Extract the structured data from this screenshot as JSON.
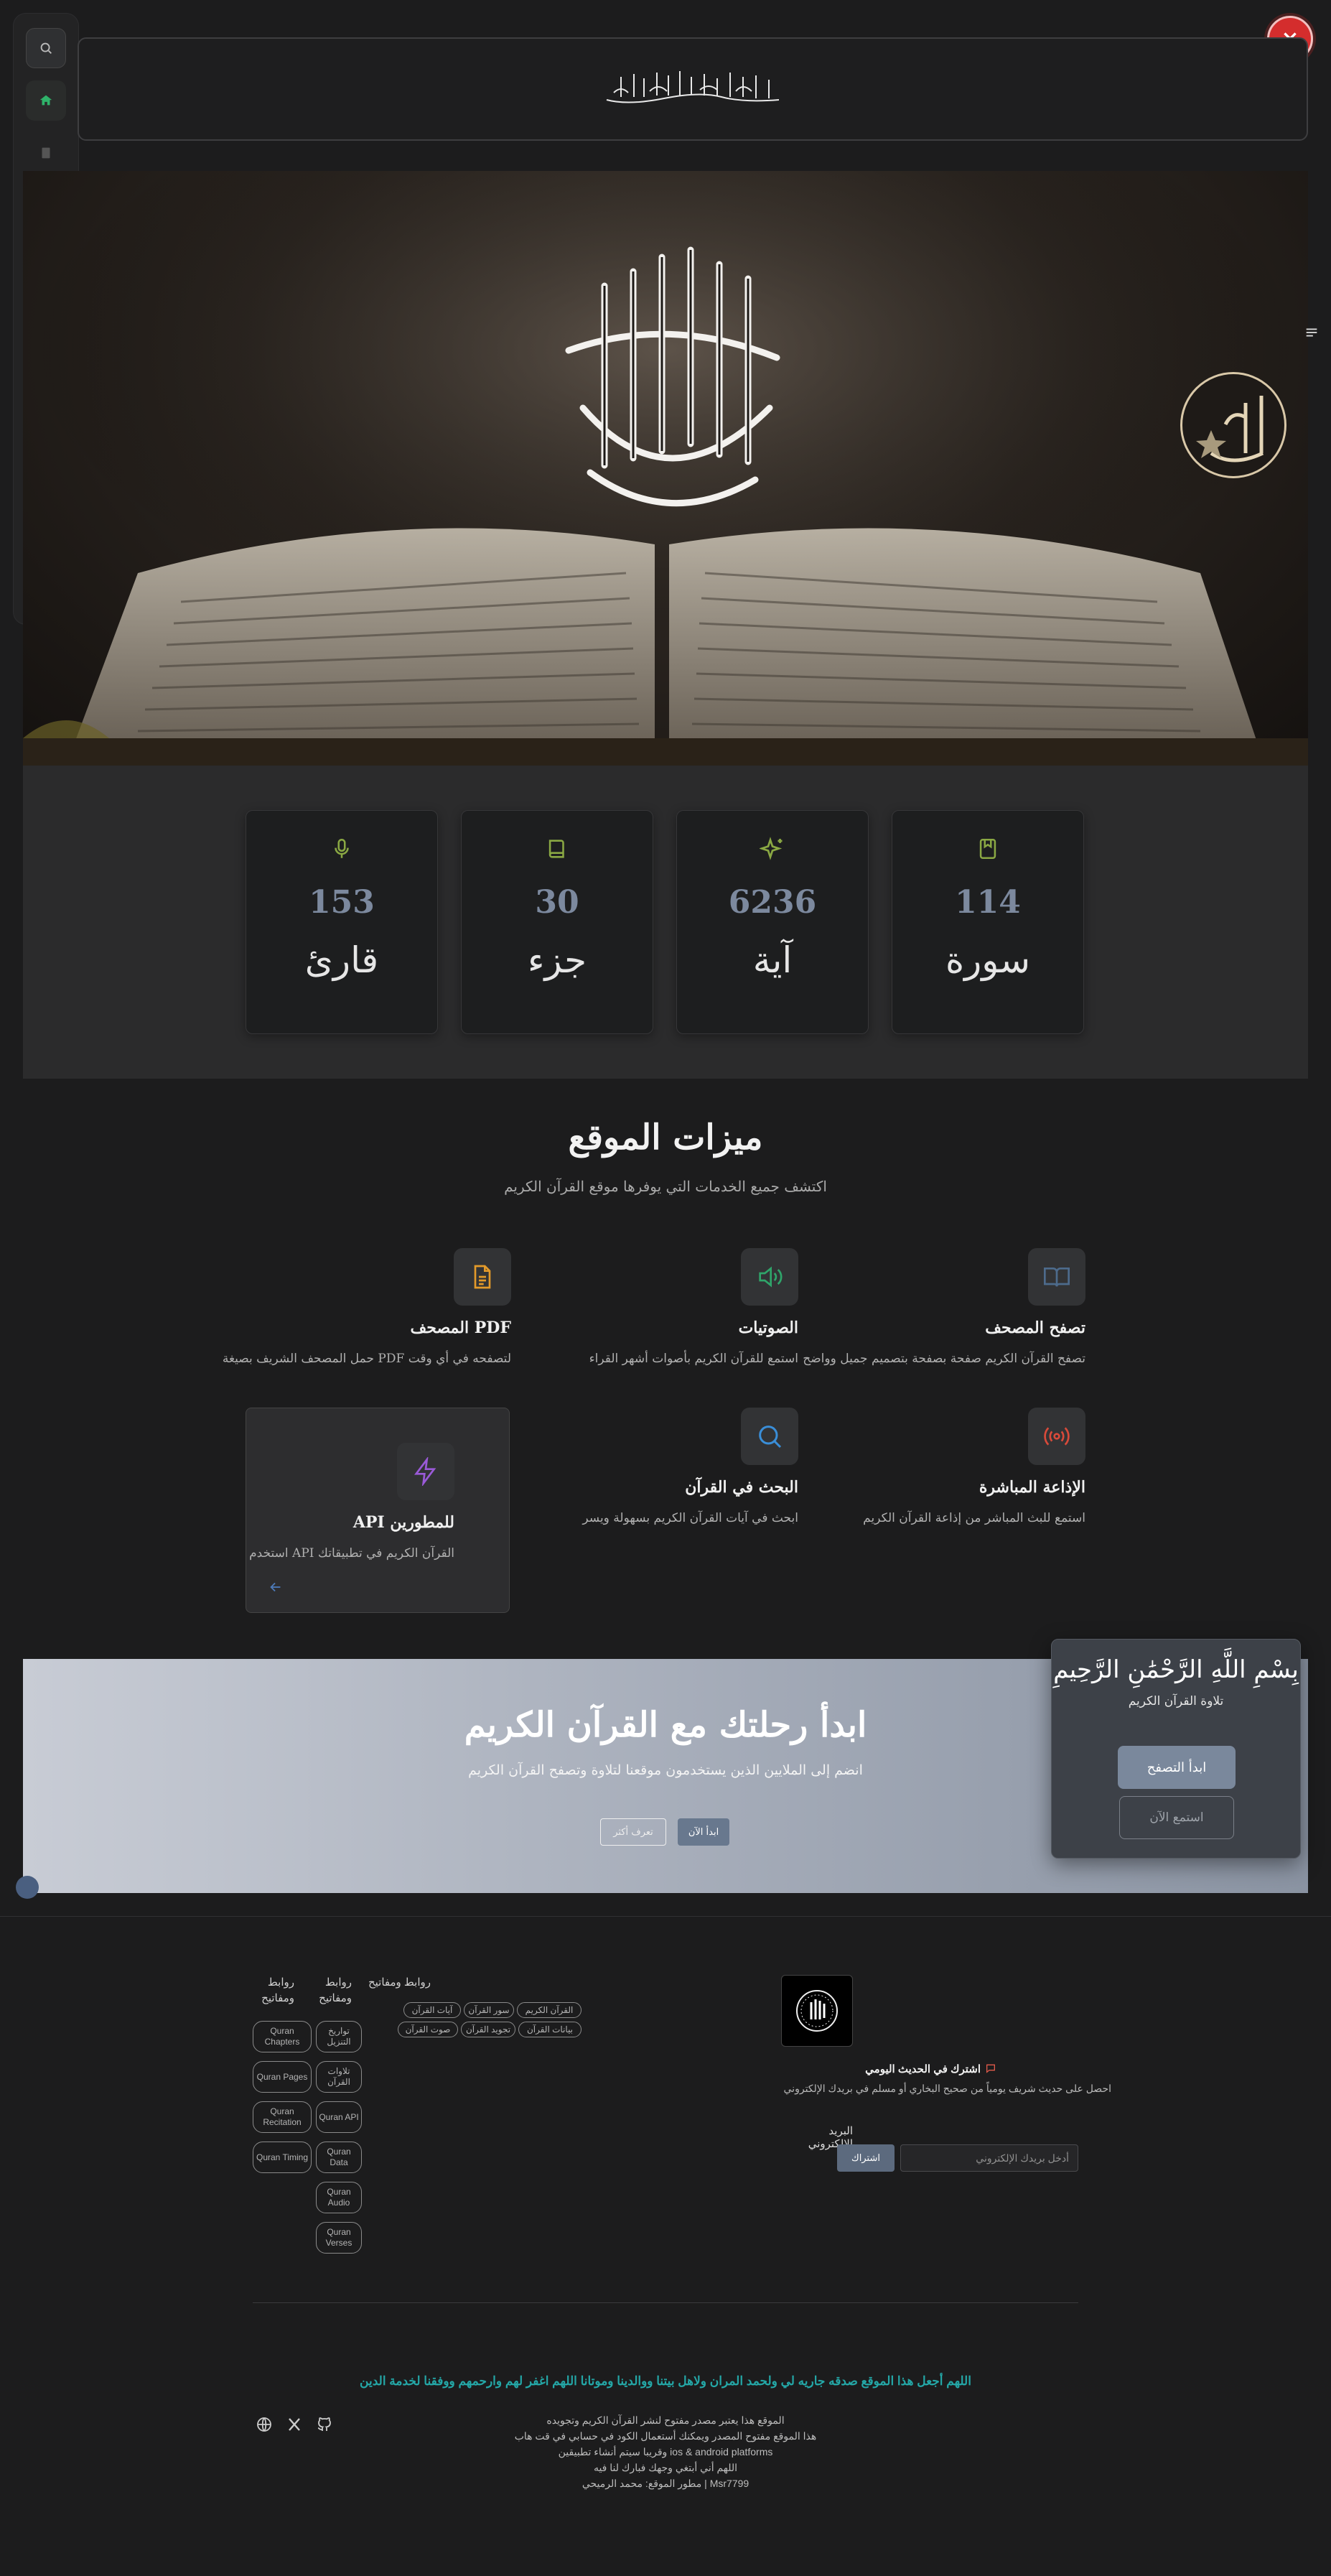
{
  "header": {
    "basmala": "بسم الله الرحمن الرحيم"
  },
  "hero": {
    "calligraphy": "القرآن الكريم",
    "badge": "الم"
  },
  "sidebar": {
    "items": [
      {
        "icon": "search-icon"
      },
      {
        "icon": "home-icon"
      },
      {
        "icon": "book-icon"
      },
      {
        "icon": "reader-icon"
      },
      {
        "icon": "audio-icon"
      },
      {
        "icon": "mushaf-icon"
      },
      {
        "icon": "video-icon"
      },
      {
        "icon": "bookmark-icon"
      },
      {
        "icon": "globe-icon"
      },
      {
        "icon": "sun-icon"
      }
    ]
  },
  "stats": [
    {
      "number": "114",
      "label": "سورة",
      "icon": "bookmark-icon"
    },
    {
      "number": "6236",
      "label": "آية",
      "icon": "sparkles-icon"
    },
    {
      "number": "30",
      "label": "جزء",
      "icon": "book-icon"
    },
    {
      "number": "153",
      "label": "قارئ",
      "icon": "microphone-icon"
    }
  ],
  "features": {
    "title": "ميزات الموقع",
    "subtitle": "اكتشف جميع الخدمات التي يوفرها موقع القرآن الكريم",
    "items": [
      {
        "title": "تصفح المصحف",
        "desc": "تصفح القرآن الكريم صفحة بصفحة بتصميم جميل وواضح",
        "icon": "open-book-icon",
        "color": "#4d6b8c"
      },
      {
        "title": "الصوتيات",
        "desc": "استمع للقرآن الكريم بأصوات أشهر القراء",
        "icon": "speaker-icon",
        "color": "#2fa56a"
      },
      {
        "title": "المصحف PDF",
        "desc": "حمل المصحف الشريف بصيغة PDF لتصفحه في أي وقت",
        "icon": "document-icon",
        "color": "#e39a2a"
      },
      {
        "title": "الإذاعة المباشرة",
        "desc": "استمع للبث المباشر من إذاعة القرآن الكريم",
        "icon": "radio-icon",
        "color": "#d84a3a"
      },
      {
        "title": "البحث في القرآن",
        "desc": "ابحث في آيات القرآن الكريم بسهولة ويسر",
        "icon": "search-icon",
        "color": "#3a8ed8"
      },
      {
        "title": "API للمطورين",
        "desc": "استخدم API القرآن الكريم في تطبيقاتك",
        "icon": "lightning-icon",
        "color": "#9a5ad8"
      }
    ]
  },
  "cta": {
    "title": "ابدأ رحلتك مع القرآن الكريم",
    "subtitle": "انضم إلى الملايين الذين يستخدمون موقعنا لتلاوة وتصفح القرآن الكريم",
    "primary": "ابدأ الآن",
    "secondary": "تعرف أكثر"
  },
  "popup": {
    "title": "بِسْمِ اللَّهِ الرَّحْمَٰنِ الرَّحِيمِ",
    "subtitle": "تلاوة القرآن الكريم",
    "primary": "ابدأ التصفح",
    "secondary": "استمع الآن"
  },
  "footer": {
    "col_titles": [
      "روابط ومفاتيح",
      "روابط ومفاتيح",
      "روابط ومفاتيح"
    ],
    "links_a": [
      "القرآن الكريم",
      "سور القرآن",
      "آيات القرآن",
      "بيانات القرآن",
      "تجويد القرآن",
      "صوت القرآن"
    ],
    "links_b": [
      "تواريخ التنزيل",
      "تلاوات القرآن",
      "Quran API",
      "Quran Data",
      "Quran Audio",
      "Quran Verses"
    ],
    "links_c": [
      "Quran Chapters",
      "Quran Pages",
      "Quran Recitation",
      "Quran Timing"
    ],
    "newsletter_title": "اشترك في الحديث اليومي",
    "newsletter_desc": "احصل على حديث شريف يومياً من صحيح البخاري أو مسلم في بريدك الإلكتروني",
    "email_label": "البريد الإلكتروني",
    "email_placeholder": "أدخل بريدك الإلكتروني",
    "subscribe": "اشتراك",
    "dua": "اللهم أجعل هذا الموقع صدقه جاريه لي ولحمد المران ولاهل بيتنا ووالدينا وموتانا اللهم اغفر لهم وارحمهم ووفقنا لخدمة الدين",
    "credits": [
      "الموقع هذا يعتبر مصدر مفتوح لنشر القرآن الكريم وتجويده",
      "هذا الموقع مفتوح المصدر ويمكنك أستعمال الكود في حسابي في قت هاب",
      "وقريبا سيتم أنشاء تطبيقين ios & android platforms",
      "اللهم أني أبتغي وجهك فبارك لنا فيه",
      "مطور الموقع: محمد الرميحي | Msr7799"
    ]
  }
}
